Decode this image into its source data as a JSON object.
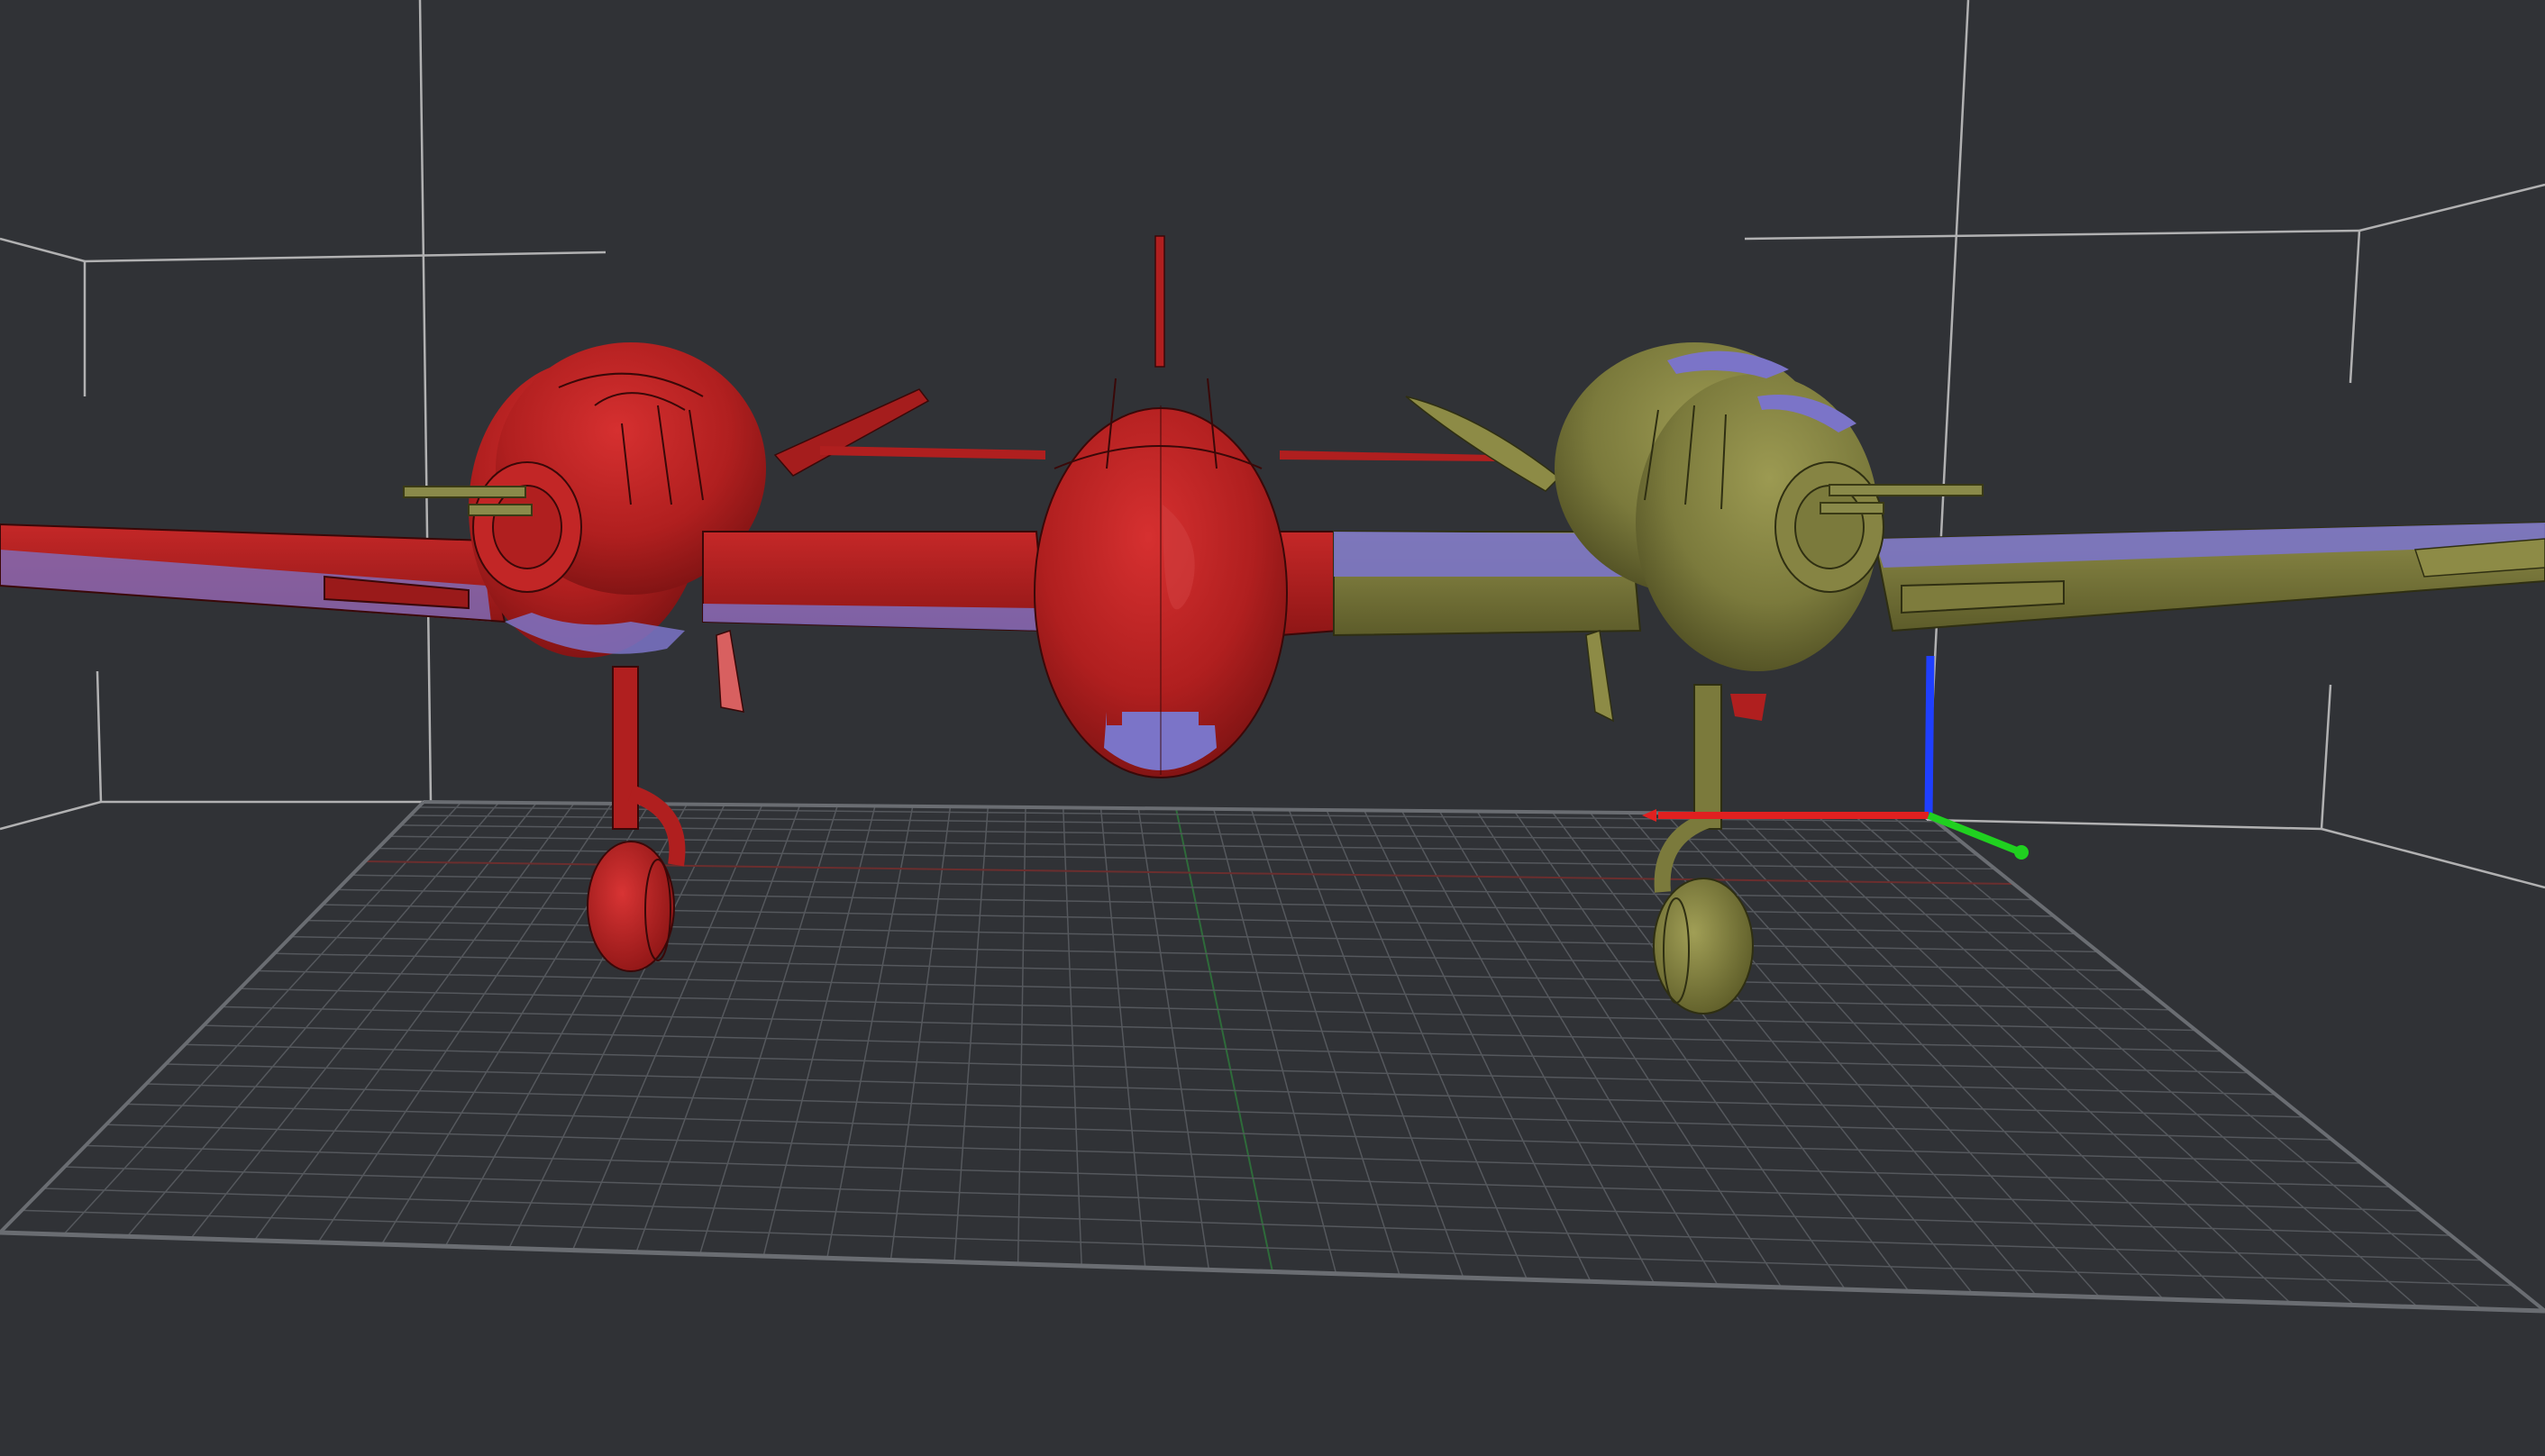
{
  "viewport": {
    "background": "#303236",
    "grid_color": "#55585d",
    "bounding_box_color": "#c8c8c8"
  },
  "scene": {
    "objects": [
      {
        "name": "left-engine-nacelle",
        "color": "#b01f1f",
        "highlight_color": "#7b74c8",
        "selected": true
      },
      {
        "name": "central-fuselage-pod",
        "color": "#b01f1f",
        "highlight_color": "#7b74c8",
        "selected": true
      },
      {
        "name": "right-engine-nacelle",
        "color": "#7b7a3c",
        "highlight_color": "#7b74c8",
        "selected": false
      }
    ]
  },
  "gizmo": {
    "x_color": "#e02020",
    "y_color": "#20d020",
    "z_color": "#1f3fff"
  }
}
